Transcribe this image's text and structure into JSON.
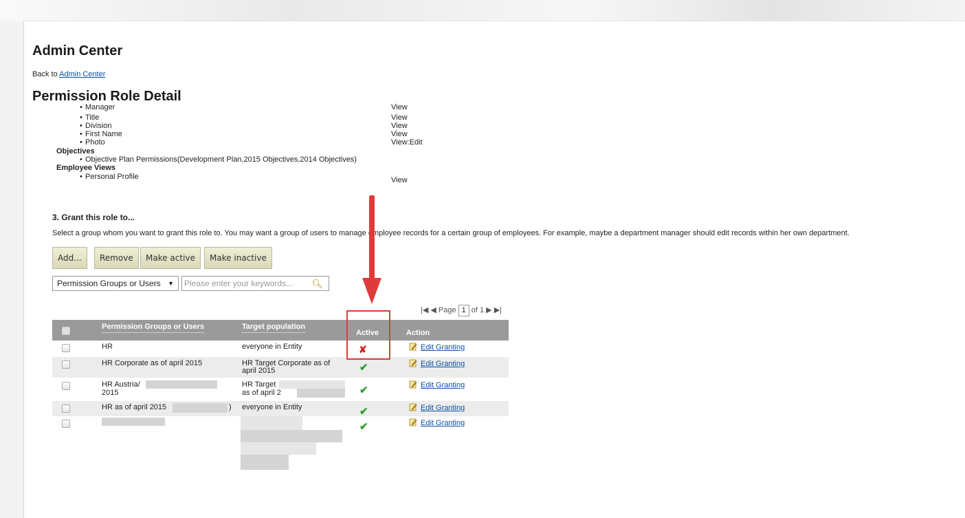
{
  "header": {
    "title": "Admin Center",
    "back_prefix": "Back to",
    "back_link": "Admin Center",
    "subtitle": "Permission Role Detail"
  },
  "permissions": {
    "cut_item": {
      "label": "Manager",
      "value": "View"
    },
    "items": [
      {
        "label": "Title",
        "value": "View"
      },
      {
        "label": "Division",
        "value": "View"
      },
      {
        "label": "First Name",
        "value": "View"
      },
      {
        "label": "Photo",
        "value": "View:Edit"
      }
    ],
    "objectives_heading": "Objectives",
    "objectives_item": "Objective Plan Permissions(Development Plan,2015 Objectives,2014 Objectives)",
    "employee_views_heading": "Employee Views",
    "employee_views_item": {
      "label": "Personal Profile",
      "value": "View"
    }
  },
  "grant": {
    "heading": "3. Grant this role to...",
    "description": "Select a group whom you want to grant this role to. You may want a group of users to manage employee records for a certain group of employees. For example, maybe a department manager should edit records within her own department.",
    "buttons": {
      "add": "Add...",
      "remove": "Remove",
      "make_active": "Make active",
      "make_inactive": "Make inactive"
    },
    "filter_select": "Permission Groups or Users",
    "search_placeholder": "Please enter your keywords..."
  },
  "pager": {
    "page_label": "Page",
    "current": "1",
    "of_label": "of 1"
  },
  "table": {
    "columns": {
      "group": "Permission Groups or Users",
      "target": "Target population",
      "active": "Active",
      "action": "Action"
    },
    "rows": [
      {
        "group": "HR",
        "target": "everyone in Entity",
        "active": false,
        "action": "Edit Granting"
      },
      {
        "group": "HR Corporate as of april 2015",
        "target": "HR Target Corporate as of april 2015",
        "active": true,
        "action": "Edit Granting"
      },
      {
        "group": "HR Austria/",
        "group2": "2015",
        "target": "HR Target",
        "target2": "as of april 2",
        "active": true,
        "action": "Edit Granting"
      },
      {
        "group": "HR as of april 2015",
        "group_tail": ")",
        "target": "everyone in Entity",
        "active": true,
        "action": "Edit Granting"
      },
      {
        "group": "",
        "target": "",
        "active": true,
        "action": "Edit Granting"
      }
    ]
  },
  "colors": {
    "header_bg": "#9a9a9a",
    "active_check": "#2e9b2e",
    "inactive_x": "#cc2222",
    "annotation": "#e03b3b",
    "link": "#0a4fa8"
  },
  "icons": {
    "active": "check-icon",
    "inactive": "x-icon",
    "edit": "pencil-icon",
    "search": "magnifier-icon"
  }
}
